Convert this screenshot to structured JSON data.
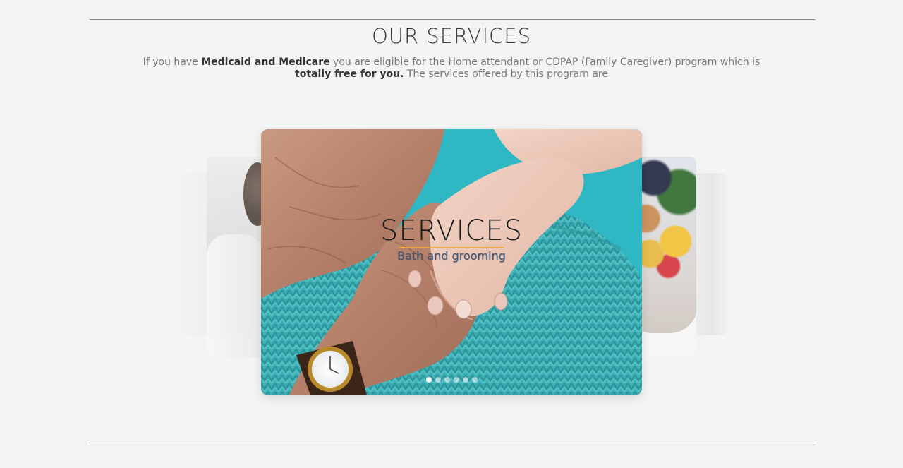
{
  "section": {
    "title": "OUR SERVICES",
    "intro": {
      "part1": "If you have ",
      "bold1": "Medicaid and Medicare",
      "part2": " you are eligible for the Home attendant or CDPAP (Family Caregiver) program which is ",
      "bold2": "totally free for you.",
      "part3": " The services offered by this program are"
    }
  },
  "carousel": {
    "active_slide": {
      "title": "SERVICES",
      "subtitle": "Bath and grooming"
    },
    "dots_count": 6,
    "active_dot": 1
  },
  "colors": {
    "background": "#f4f4f4",
    "accent_underline": "#f0a92c",
    "sweater": "#3fb3b8",
    "scrubs": "#2fb7c4"
  }
}
